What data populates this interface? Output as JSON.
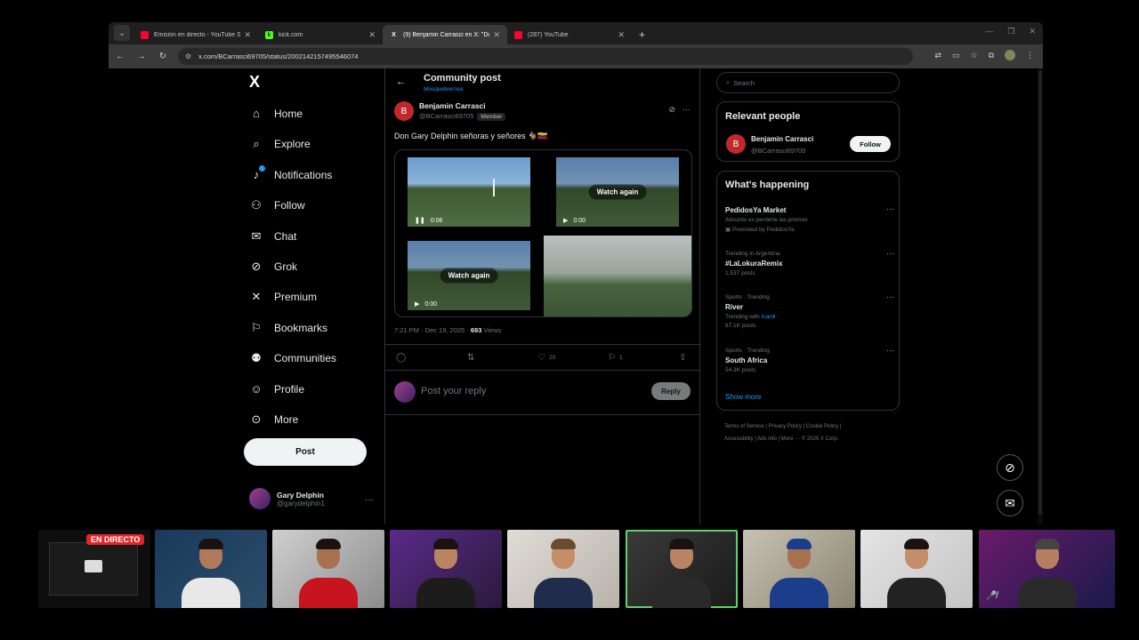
{
  "browser": {
    "tabs": [
      {
        "label": "Emisión en directo - YouTube Stu",
        "favicon": "yt"
      },
      {
        "label": "kick.com",
        "favicon": "kick"
      },
      {
        "label": "(9) Benjamin Carrasci en X: \"Don",
        "favicon": "x",
        "active": true
      },
      {
        "label": "(287) YouTube",
        "favicon": "yt"
      }
    ],
    "url": "x.com/BCarrasci69705/status/2002142157495546074"
  },
  "nav": {
    "logo": "X",
    "items": [
      {
        "label": "Home",
        "icon": "home-icon",
        "glyph": "⌂"
      },
      {
        "label": "Explore",
        "icon": "search-icon",
        "glyph": "⌕"
      },
      {
        "label": "Notifications",
        "icon": "bell-icon",
        "glyph": "🔔"
      },
      {
        "label": "Follow",
        "icon": "add-person-icon",
        "glyph": "⚇"
      },
      {
        "label": "Chat",
        "icon": "mail-icon",
        "glyph": "✉"
      },
      {
        "label": "Grok",
        "icon": "grok-icon",
        "glyph": "⊘"
      },
      {
        "label": "Premium",
        "icon": "x-icon",
        "glyph": "𝕏"
      },
      {
        "label": "Bookmarks",
        "icon": "bookmark-icon",
        "glyph": "⚐"
      },
      {
        "label": "Communities",
        "icon": "people-icon",
        "glyph": "⚉"
      },
      {
        "label": "Profile",
        "icon": "person-icon",
        "glyph": "☺"
      },
      {
        "label": "More",
        "icon": "more-circle-icon",
        "glyph": "⋯"
      }
    ],
    "post_label": "Post",
    "me": {
      "name": "Gary Delphin",
      "handle": "@garydelphin1"
    }
  },
  "post": {
    "header_title": "Community post",
    "header_sub": "Mosqueteernos",
    "author_name": "Benjamin Carrasci",
    "author_handle": "@BCarrasci69705",
    "author_initial": "B",
    "member_badge": "Member",
    "text": "Don Gary Delphin señoras y señores 🐐🇻🇪",
    "videos": [
      {
        "time": "0:06",
        "state": "pause",
        "overlay": ""
      },
      {
        "time": "0:00",
        "state": "play",
        "overlay": "Watch again"
      },
      {
        "time": "0:00",
        "state": "play",
        "overlay": "Watch again"
      }
    ],
    "time_date": "7:21 PM · Dec 19, 2025 · ",
    "views_count": "693",
    "views_label": " Views",
    "likes": "20",
    "bookmarks": "1",
    "reply_placeholder": "Post your reply",
    "reply_button": "Reply"
  },
  "right": {
    "search_placeholder": "Search",
    "relevant_title": "Relevant people",
    "relevant": {
      "name": "Benjamin Carrasci",
      "handle": "@BCarrasci69705",
      "initial": "B",
      "follow": "Follow"
    },
    "happening_title": "What's happening",
    "trends": [
      {
        "meta": "",
        "title": "PedidosYa Market",
        "sub": "Absurdo es perderte las promos",
        "sub2": "Promoted by PedidosYa",
        "link": ""
      },
      {
        "meta": "Trending in Argentina",
        "title": "#LaLokuraRemix",
        "sub": "1,537 posts",
        "sub2": "",
        "link": ""
      },
      {
        "meta": "Sports · Trending",
        "title": "River",
        "sub": "Trending with ",
        "link": "Icardi",
        "sub2": "67.1K posts"
      },
      {
        "meta": "Sports · Trending",
        "title": "South Africa",
        "sub": "54.3K posts",
        "sub2": "",
        "link": ""
      }
    ],
    "show_more": "Show more",
    "footer_line1": "Terms of Service  |  Privacy Policy  |  Cookie Policy  |",
    "footer_line2": "Accessibility  |  Ads info  |  More ···  © 2025 X Corp."
  },
  "stream": {
    "live_badge": "EN DIRECTO"
  },
  "colors": {
    "accent": "#1d9bf0",
    "live": "#e0262b",
    "selected_cam": "#5fd36b"
  }
}
